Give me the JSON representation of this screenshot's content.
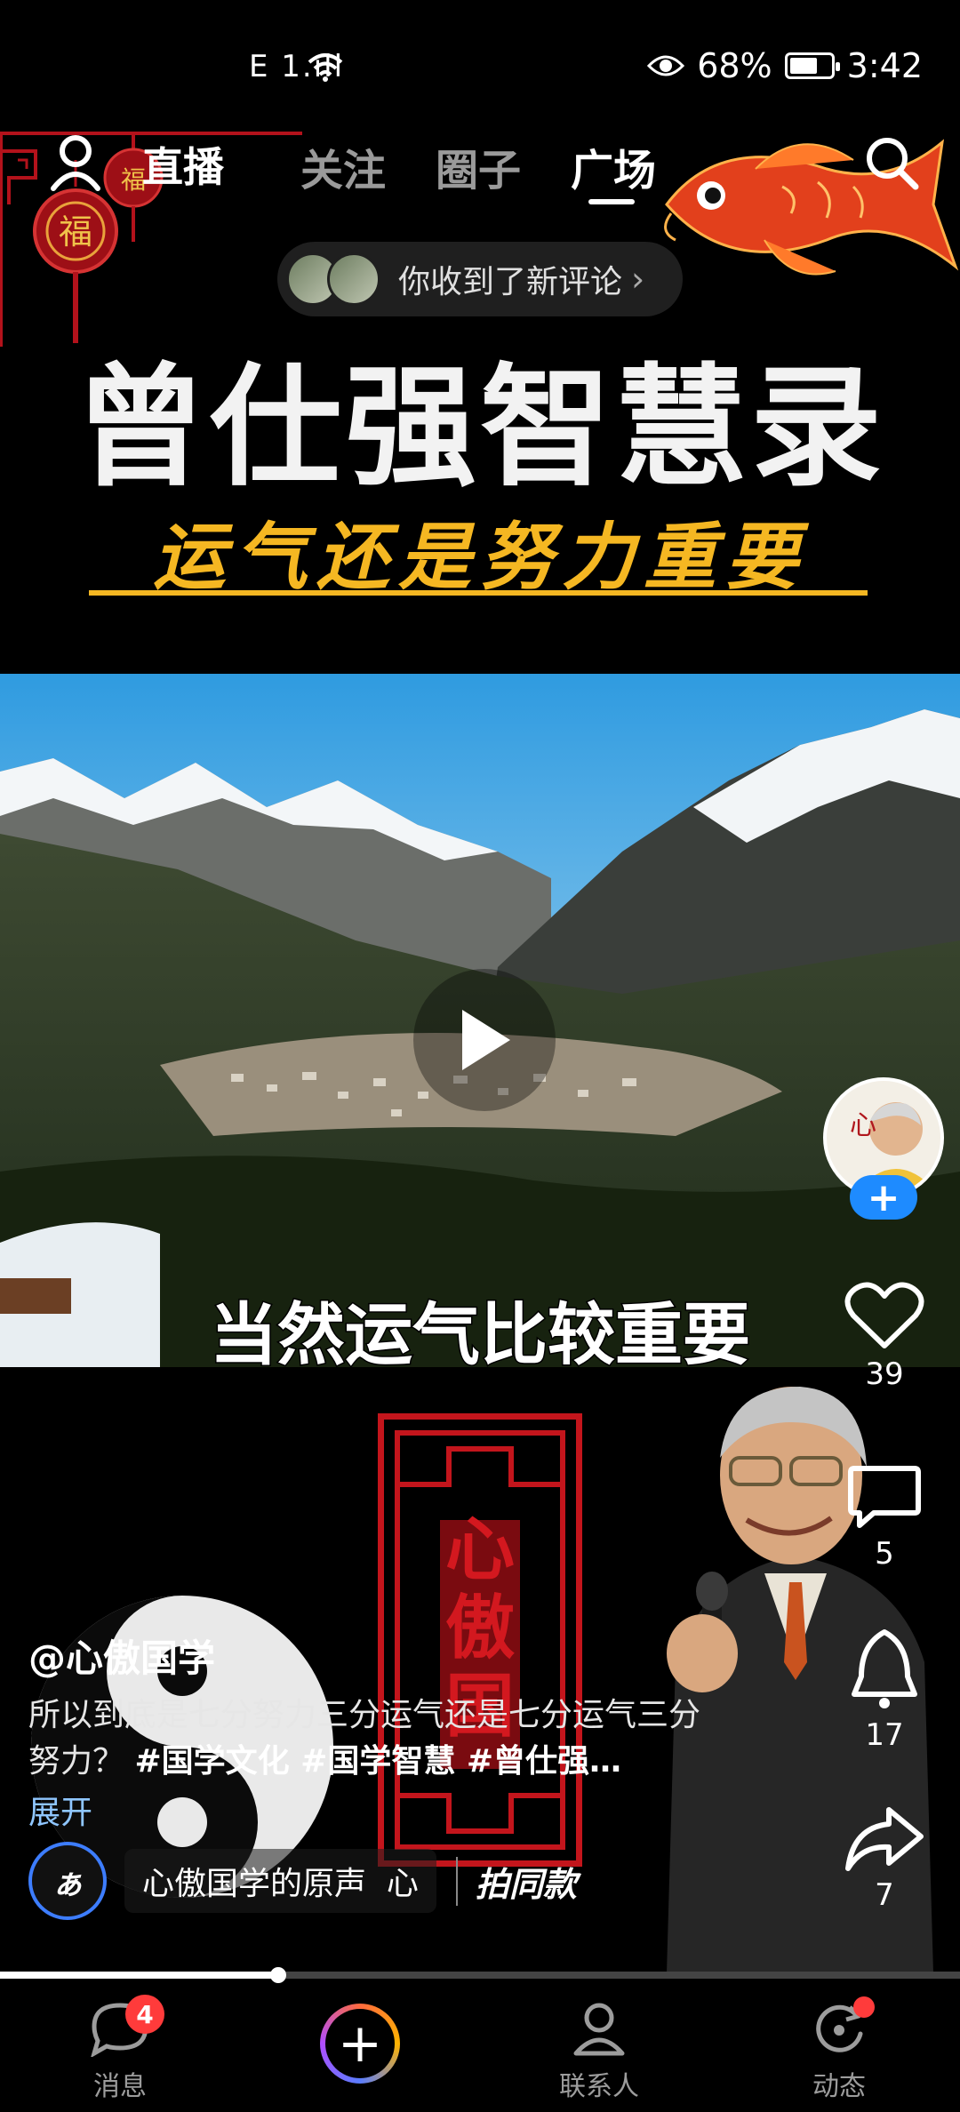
{
  "status_bar": {
    "signal_text": "E 1.ıll",
    "battery_percent": "68%",
    "battery_level": 0.68,
    "time": "3:42"
  },
  "top_nav": {
    "live": "直播",
    "tabs": [
      "关注",
      "圈子",
      "广场"
    ],
    "active_tab": "广场"
  },
  "notification": {
    "text": "你收到了新评论",
    "chevron": "›"
  },
  "video": {
    "title": "曾仕强智慧录",
    "subtitle": "运气还是努力重要",
    "caption_overlay": "当然运气比较重要",
    "seal_text": "心傲国",
    "progress": 0.29
  },
  "actions": {
    "follow": "+",
    "likes": "39",
    "comments": "5",
    "favorites": "17",
    "shares": "7"
  },
  "post": {
    "author": "@心傲国学",
    "description": "所以到底是七分努力三分运气还是七分运气三分努力？",
    "tags": "#国学文化 #国学智慧 #曾仕强…",
    "expand": "展开",
    "music_source": "心傲国学的原声",
    "music_disc_letter": "ぁ",
    "music_tail": "心",
    "same_style": "拍同款"
  },
  "bottom_nav": {
    "messages": "消息",
    "messages_badge": "4",
    "create": "+",
    "contacts": "联系人",
    "activity": "动态"
  },
  "colors": {
    "accent_blue": "#1e8bff",
    "title_gold": "#f5b722",
    "badge_red": "#ff3b3b"
  }
}
